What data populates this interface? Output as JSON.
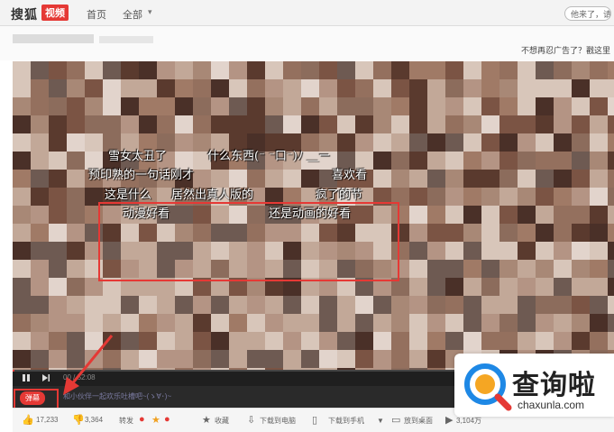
{
  "header": {
    "logo": "搜狐",
    "logo_badge": "视频",
    "nav_home": "首页",
    "nav_all": "全部",
    "search_placeholder": "他来了，请",
    "ad_notice": "不想再忍广告了？戳这里"
  },
  "danmaku": {
    "lines": [
      "雪女太丑了",
      "什么东西(⁻ ⁻口⁻)ﾉ ＿ー",
      "预印熟的一句话刚才",
      "喜欢看",
      "这是什么",
      "居然出真人版的",
      "疯了的节",
      "动漫好看",
      "还是动画的好看"
    ]
  },
  "player": {
    "time": "00 / 52:08",
    "danmaku_toggle": "弹幕",
    "danmaku_input_placeholder": "和小伙伴一起欢乐吐槽吧~(ゝ∀･)~"
  },
  "actions": {
    "likes": "17,233",
    "dislikes": "3,364",
    "share": "转发",
    "favorite": "收藏",
    "download_pc": "下载到电脑",
    "download_phone": "下载到手机",
    "desktop": "放到桌面",
    "plays": "3,104万"
  },
  "watermark": {
    "cn": "查询啦",
    "en": "chaxunla.com"
  },
  "colors": {
    "accent": "#e53935"
  }
}
